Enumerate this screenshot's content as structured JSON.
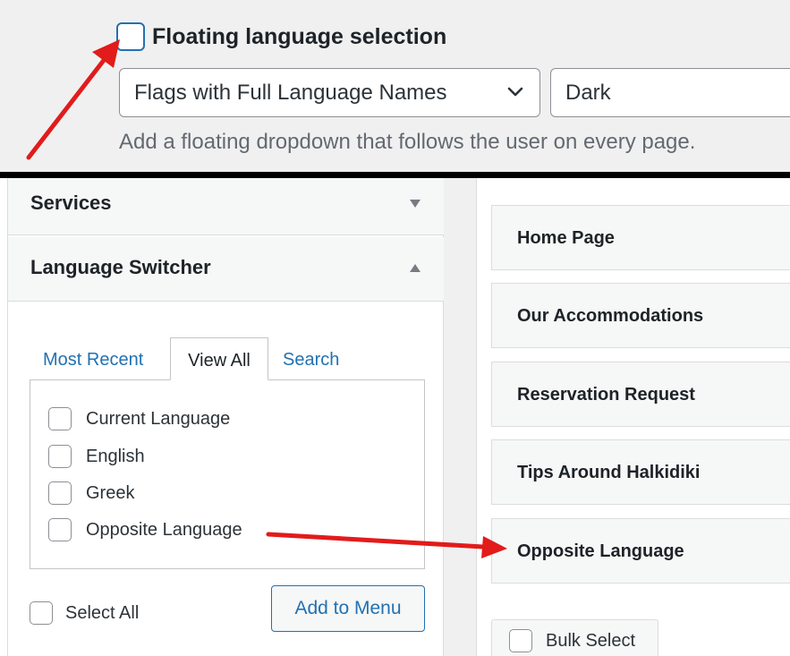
{
  "settings": {
    "floating_label": "Floating language selection",
    "floating_checked": false,
    "style_select_value": "Flags with Full Language Names",
    "theme_select_value": "Dark",
    "description": "Add a floating dropdown that follows the user on every page."
  },
  "menu_items_panel": {
    "services_title": "Services",
    "language_switcher_title": "Language Switcher",
    "tabs": [
      "Most Recent",
      "View All",
      "Search"
    ],
    "active_tab": "View All",
    "items": [
      {
        "label": "Current Language",
        "checked": false
      },
      {
        "label": "English",
        "checked": false
      },
      {
        "label": "Greek",
        "checked": false
      },
      {
        "label": "Opposite Language",
        "checked": false
      }
    ],
    "select_all_label": "Select All",
    "add_button_label": "Add to Menu"
  },
  "menu_structure": {
    "items": [
      "Home Page",
      "Our Accommodations",
      "Reservation Request",
      "Tips Around Halkidiki",
      "Opposite Language"
    ],
    "bulk_select_label": "Bulk Select"
  },
  "colors": {
    "accent": "#2271b1",
    "annotation_arrow": "#e21b1b",
    "panel_bg": "#f0f0f1"
  }
}
